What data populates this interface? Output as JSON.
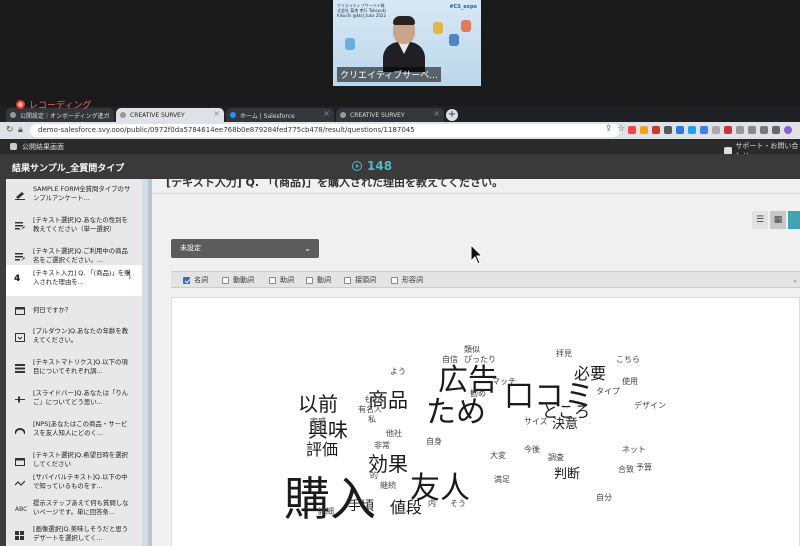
{
  "video": {
    "banner_left": "クリエイティブサーベイ株式会社 菊地 孝行 Takayuki Kikuchi @kkd_tuka 2022",
    "banner_right": "#CS_expo",
    "name": "クリエイティブサーベ..."
  },
  "recording": {
    "label": "レコーディング"
  },
  "browser": {
    "tabs": [
      {
        "label": "公開設定｜オンボーディング進ガ"
      },
      {
        "label": "CREATIVE SURVEY"
      },
      {
        "label": "ホーム | Salesforce"
      },
      {
        "label": "CREATIVE SURVEY"
      }
    ],
    "new_tab": "+",
    "url": "demo-salesforce.svy.ooo/public/0972f0da5784614ee768b0e879284fed775cb478/result/questions/1187045",
    "bookmark_left": "公開結果画面",
    "bookmark_right": "サポート・お問い合わせ"
  },
  "header": {
    "title": "結果サンプル_全質問タイプ",
    "response_count": "148"
  },
  "sidebar": {
    "items": [
      {
        "label": "SAMPLE FORM全質問タイプのサンプルアンケート...",
        "icon": "form-icon"
      },
      {
        "label": "[テキスト選択]Q.あなたの性別を教えてください（単一選択）",
        "icon": "radio-list-icon"
      },
      {
        "label": "[テキスト選択]Q.ご利用中の商品名をご選択ください。...",
        "icon": "checkbox-list-icon"
      },
      {
        "num": "4",
        "label": "[テキスト入力] Q. 「(商品)」を購入された理由を...",
        "icon": "chevron-right-icon"
      },
      {
        "label": "何日ですか？",
        "icon": "calendar-icon"
      },
      {
        "label": "[プルダウン]Q.あなたの年齢を教えてください。",
        "icon": "dropdown-icon"
      },
      {
        "label": "[テキストマトリクス]Q.以下の項目についてそれぞれ調...",
        "icon": "matrix-icon"
      },
      {
        "label": "[スライドバー]Q.あなたは「りんご」についてどう思い...",
        "icon": "slider-icon"
      },
      {
        "label": "[NPS]あなたはこの商品・サービスを友人知人にどのく...",
        "icon": "gauge-icon"
      },
      {
        "label": "[テキスト選択]Q.希望日時を選択してください",
        "icon": "calendar-icon"
      },
      {
        "label": "[サバイバルテキスト]Q.以下の中で知っているものをす...",
        "icon": "survival-icon"
      },
      {
        "label": "提示ステップあえて何も質問しないページです。単に回答条...",
        "icon": "abc-icon"
      },
      {
        "label": "[画像選択]Q.美味しそうだと思うデザートを選択してく...",
        "icon": "image-select-icon"
      }
    ]
  },
  "main": {
    "question_title": "[テキスト入力] Q. 「(商品)」を購入された理由を教えてください。",
    "view_buttons": [
      "list-view-icon",
      "grid-view-icon"
    ],
    "dropdown_value": "未設定",
    "filters": [
      {
        "label": "名詞",
        "checked": true
      },
      {
        "label": "動動詞",
        "checked": false
      },
      {
        "label": "助詞",
        "checked": false
      },
      {
        "label": "動詞",
        "checked": false
      },
      {
        "label": "接頭詞",
        "checked": false
      },
      {
        "label": "形容詞",
        "checked": false
      }
    ]
  },
  "word_cloud": {
    "words": [
      "購入",
      "ため",
      "口コミ",
      "広告",
      "友人",
      "商品",
      "興味",
      "効果",
      "以前",
      "必要",
      "評価",
      "値段",
      "手頃",
      "ところ",
      "判断",
      "決意",
      "類似",
      "ぴったり",
      "自信",
      "拝見",
      "こちら",
      "使用",
      "タイプ",
      "デザイン",
      "マッチ",
      "勧め",
      "サイズ",
      "よう",
      "もの",
      "有名人",
      "私",
      "実感",
      "他社",
      "非常",
      "自身",
      "今後",
      "大変",
      "調査",
      "ネット",
      "合致",
      "予算",
      "満足",
      "継続",
      "的",
      "内",
      "そう",
      "詳細",
      "自分"
    ]
  },
  "colors": {
    "accent": "#4fb8c7",
    "header_bg": "#3a3a3a",
    "checkbox_on": "#2d6fd3"
  }
}
